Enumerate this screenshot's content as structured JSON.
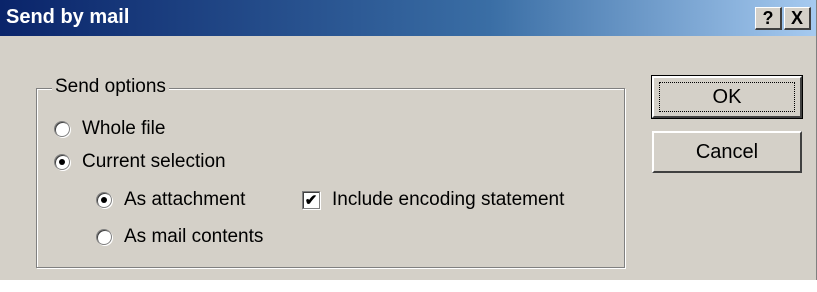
{
  "window": {
    "title": "Send by mail",
    "help_label": "?",
    "close_label": "X"
  },
  "send_options": {
    "legend": "Send options",
    "whole_file": {
      "label": "Whole file",
      "checked": false
    },
    "current_selection": {
      "label": "Current selection",
      "checked": true
    },
    "as_attachment": {
      "label": "As attachment",
      "checked": true
    },
    "as_mail_contents": {
      "label": "As mail contents",
      "checked": false
    },
    "include_encoding": {
      "label": "Include encoding statement",
      "checked": true,
      "mark": "✔"
    }
  },
  "buttons": {
    "ok_label": "OK",
    "cancel_label": "Cancel"
  },
  "colors": {
    "face": "#d4d0c8",
    "title_start": "#0a246a",
    "title_end": "#a6caf0"
  }
}
